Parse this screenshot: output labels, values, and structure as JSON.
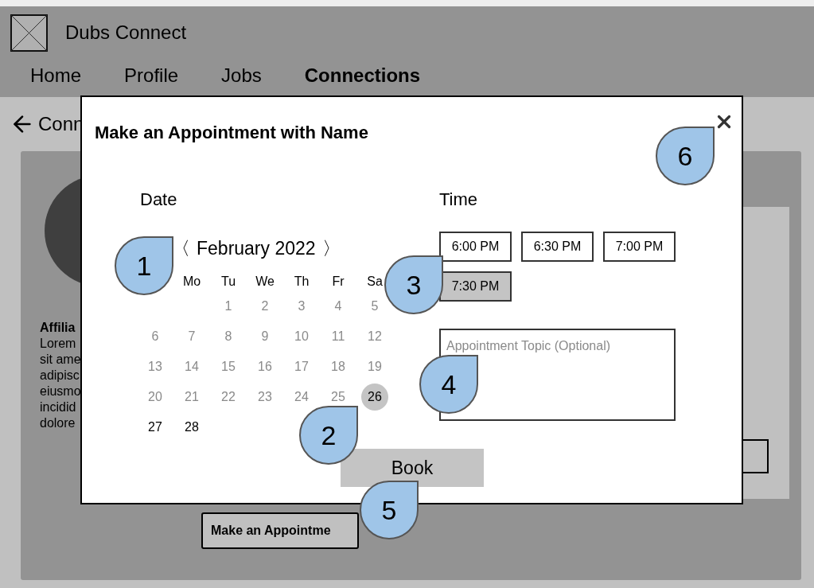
{
  "header": {
    "title": "Dubs Connect"
  },
  "nav": [
    {
      "label": "Home",
      "selected": false
    },
    {
      "label": "Profile",
      "selected": false
    },
    {
      "label": "Jobs",
      "selected": false
    },
    {
      "label": "Connections",
      "selected": true
    }
  ],
  "back_link": "Conn",
  "profile": {
    "heading": "Affilia",
    "lines": [
      "Lorem",
      "sit ame",
      "adipisc",
      "eiusmo",
      "incidid",
      "dolore"
    ],
    "button": "Make an Appointme"
  },
  "modal": {
    "title": "Make an Appointment with Name",
    "date": {
      "label": "Date",
      "prev": "〈",
      "month": "February 2022",
      "next": "〉",
      "weekdays": [
        "Mo",
        "Tu",
        "We",
        "Th",
        "Fr",
        "Sa"
      ],
      "weeks": [
        [
          {
            "day": "1",
            "disabled": true,
            "selected": false
          },
          {
            "day": "2",
            "disabled": true,
            "selected": false
          },
          {
            "day": "3",
            "disabled": true,
            "selected": false
          },
          {
            "day": "4",
            "disabled": true,
            "selected": false
          },
          {
            "day": "5",
            "disabled": true,
            "selected": false
          }
        ],
        [
          {
            "day": "6",
            "disabled": true,
            "selected": false
          },
          {
            "day": "7",
            "disabled": true,
            "selected": false
          },
          {
            "day": "8",
            "disabled": true,
            "selected": false
          },
          {
            "day": "9",
            "disabled": true,
            "selected": false
          },
          {
            "day": "10",
            "disabled": true,
            "selected": false
          },
          {
            "day": "11",
            "disabled": true,
            "selected": false
          },
          {
            "day": "12",
            "disabled": true,
            "selected": false
          }
        ],
        [
          {
            "day": "13",
            "disabled": true,
            "selected": false
          },
          {
            "day": "14",
            "disabled": true,
            "selected": false
          },
          {
            "day": "15",
            "disabled": true,
            "selected": false
          },
          {
            "day": "16",
            "disabled": true,
            "selected": false
          },
          {
            "day": "17",
            "disabled": true,
            "selected": false
          },
          {
            "day": "18",
            "disabled": true,
            "selected": false
          },
          {
            "day": "19",
            "disabled": true,
            "selected": false
          }
        ],
        [
          {
            "day": "20",
            "disabled": true,
            "selected": false
          },
          {
            "day": "21",
            "disabled": true,
            "selected": false
          },
          {
            "day": "22",
            "disabled": true,
            "selected": false
          },
          {
            "day": "23",
            "disabled": true,
            "selected": false
          },
          {
            "day": "24",
            "disabled": true,
            "selected": false
          },
          {
            "day": "25",
            "disabled": true,
            "selected": false
          },
          {
            "day": "26",
            "disabled": false,
            "selected": true
          }
        ],
        [
          {
            "day": "27",
            "disabled": false,
            "selected": false
          },
          {
            "day": "28",
            "disabled": false,
            "selected": false
          }
        ]
      ]
    },
    "time": {
      "label": "Time",
      "slots": [
        {
          "label": "6:00 PM",
          "selected": false
        },
        {
          "label": "6:30 PM",
          "selected": false
        },
        {
          "label": "7:00 PM",
          "selected": false
        },
        {
          "label": "7:30 PM",
          "selected": true
        }
      ],
      "topic_placeholder": "Appointment Topic (Optional)"
    },
    "book_button": "Book"
  },
  "callouts": [
    "1",
    "2",
    "3",
    "4",
    "5",
    "6"
  ]
}
